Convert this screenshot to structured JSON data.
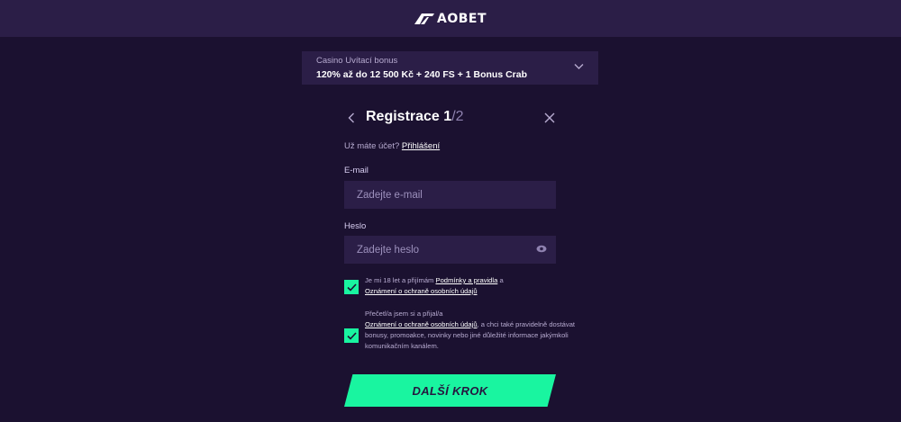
{
  "header": {
    "logo_text": "AOBET",
    "logo_icon": "aobet-logo-mark-icon"
  },
  "bonus": {
    "title": "Casino Uvítací bonus",
    "offer": "120% až do 12 500 Kč + 240 FS + 1 Bonus Crab",
    "expand_icon": "chevron-down-icon"
  },
  "registration": {
    "back_icon": "chevron-left-icon",
    "title": "Registrace",
    "step_current": "1",
    "step_total": "/2",
    "close_icon": "close-icon"
  },
  "login": {
    "prompt": "Už máte účet?",
    "link": "Přihlášení"
  },
  "form": {
    "email_label": "E-mail",
    "email_placeholder": "Zadejte e-mail",
    "email_value": "",
    "password_label": "Heslo",
    "password_placeholder": "Zadejte heslo",
    "password_value": "",
    "password_icon": "eye-icon"
  },
  "consent": {
    "age": {
      "checked": true,
      "text_1": "Je mi 18 let a přijímám",
      "link_1": "Podmínky a pravidla",
      "text_2": "a",
      "link_2": "Oznámení o ochraně osobních údajů"
    },
    "marketing": {
      "checked": true,
      "text_1": "Přečetl/a jsem si a přijal/a",
      "link_1": "Oznámení o ochraně osobních údajů",
      "text_2": ", a chci také pravidelně dostávat bonusy, promoakce, novinky nebo jiné důležité informace jakýmkoli komunikačním kanálem."
    }
  },
  "next_button": {
    "label": "DALŠÍ KROK"
  },
  "colors": {
    "background": "#1b1130",
    "panel": "#2b1e47",
    "accent": "#19f5a0",
    "muted_text": "#b7abd0"
  }
}
